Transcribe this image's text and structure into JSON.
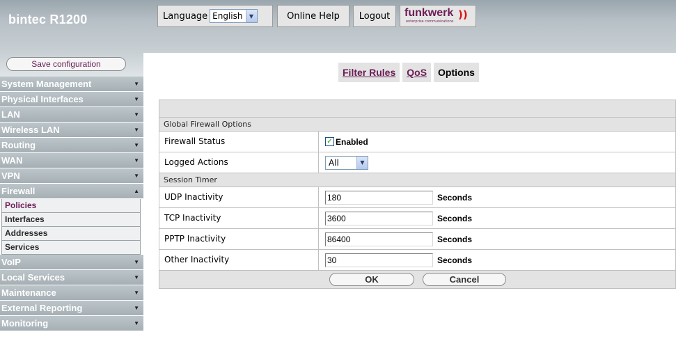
{
  "header": {
    "product": "bintec R1200",
    "language_label": "Language",
    "language_value": "English",
    "online_help": "Online Help",
    "logout": "Logout",
    "brand": "funkwerk",
    "brand_sub": "enterprise communications"
  },
  "sidebar": {
    "save_config": "Save configuration",
    "items_before": [
      {
        "label": "System Management",
        "expanded": false
      },
      {
        "label": "Physical Interfaces",
        "expanded": false
      },
      {
        "label": "LAN",
        "expanded": false
      },
      {
        "label": "Wireless LAN",
        "expanded": false
      },
      {
        "label": "Routing",
        "expanded": false
      },
      {
        "label": "WAN",
        "expanded": false
      },
      {
        "label": "VPN",
        "expanded": false
      },
      {
        "label": "Firewall",
        "expanded": true
      }
    ],
    "firewall_sub": [
      {
        "label": "Policies",
        "active": true
      },
      {
        "label": "Interfaces",
        "active": false
      },
      {
        "label": "Addresses",
        "active": false
      },
      {
        "label": "Services",
        "active": false
      }
    ],
    "items_after": [
      {
        "label": "VoIP",
        "expanded": false
      },
      {
        "label": "Local Services",
        "expanded": false
      },
      {
        "label": "Maintenance",
        "expanded": false
      },
      {
        "label": "External Reporting",
        "expanded": false
      },
      {
        "label": "Monitoring",
        "expanded": false
      }
    ]
  },
  "tabs": [
    {
      "label": "Filter Rules",
      "active": false
    },
    {
      "label": "QoS",
      "active": false
    },
    {
      "label": "Options",
      "active": true
    }
  ],
  "form": {
    "global_section": "Global Firewall Options",
    "firewall_status_label": "Firewall Status",
    "firewall_status_checked": true,
    "firewall_status_value": "Enabled",
    "logged_actions_label": "Logged Actions",
    "logged_actions_value": "All",
    "session_section": "Session Timer",
    "timers": [
      {
        "label": "UDP Inactivity",
        "value": "180",
        "unit": "Seconds"
      },
      {
        "label": "TCP Inactivity",
        "value": "3600",
        "unit": "Seconds"
      },
      {
        "label": "PPTP Inactivity",
        "value": "86400",
        "unit": "Seconds"
      },
      {
        "label": "Other Inactivity",
        "value": "30",
        "unit": "Seconds"
      }
    ],
    "ok_label": "OK",
    "cancel_label": "Cancel"
  },
  "colors": {
    "accent": "#6b1d55",
    "nav_bg": "#b1bbc0",
    "panel_bg": "#e3e3e3"
  }
}
